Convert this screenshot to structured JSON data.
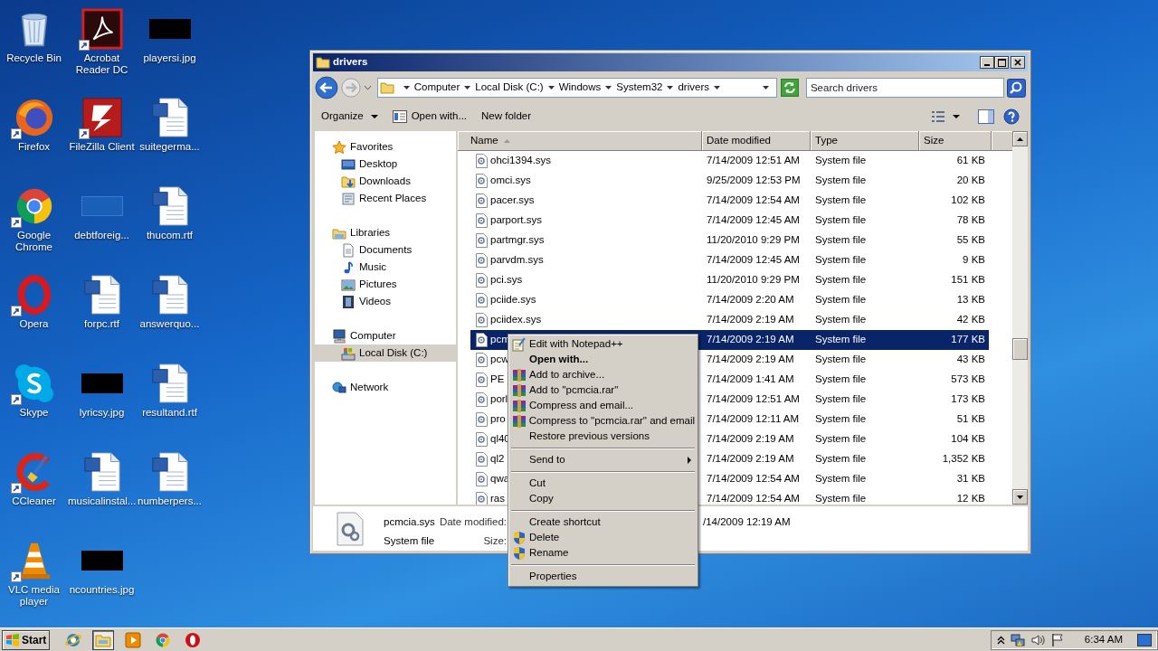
{
  "desktop": {
    "icons": [
      {
        "label": "Recycle Bin",
        "kind": "recycle",
        "shortcut": false
      },
      {
        "label": "Acrobat Reader DC",
        "kind": "acrobat",
        "shortcut": true
      },
      {
        "label": "playersi.jpg",
        "kind": "image",
        "shortcut": false
      },
      {
        "label": "Firefox",
        "kind": "firefox",
        "shortcut": true
      },
      {
        "label": "FileZilla Client",
        "kind": "filezilla",
        "shortcut": true
      },
      {
        "label": "suitegerma...",
        "kind": "word",
        "shortcut": false
      },
      {
        "label": "Google Chrome",
        "kind": "chrome",
        "shortcut": true
      },
      {
        "label": "debtforeig...",
        "kind": "blank",
        "shortcut": false
      },
      {
        "label": "thucom.rtf",
        "kind": "word",
        "shortcut": false
      },
      {
        "label": "Opera",
        "kind": "opera",
        "shortcut": true
      },
      {
        "label": "forpc.rtf",
        "kind": "word",
        "shortcut": false
      },
      {
        "label": "answerquo...",
        "kind": "word",
        "shortcut": false
      },
      {
        "label": "Skype",
        "kind": "skype",
        "shortcut": true
      },
      {
        "label": "lyricsy.jpg",
        "kind": "image",
        "shortcut": false
      },
      {
        "label": "resultand.rtf",
        "kind": "word",
        "shortcut": false
      },
      {
        "label": "CCleaner",
        "kind": "ccleaner",
        "shortcut": true
      },
      {
        "label": "musicalinstal...",
        "kind": "word",
        "shortcut": false
      },
      {
        "label": "numberpers...",
        "kind": "word",
        "shortcut": false
      },
      {
        "label": "VLC media player",
        "kind": "vlc",
        "shortcut": true
      },
      {
        "label": "ncountries.jpg",
        "kind": "image",
        "shortcut": false
      }
    ]
  },
  "explorer": {
    "title": "drivers",
    "breadcrumbs": [
      "Computer",
      "Local Disk (C:)",
      "Windows",
      "System32",
      "drivers"
    ],
    "search": {
      "placeholder": "Search drivers"
    },
    "toolbar": [
      {
        "label": "Organize",
        "kind": "menu"
      },
      {
        "label": "Open with...",
        "kind": "open"
      },
      {
        "label": "New folder",
        "kind": "plain"
      }
    ],
    "nav": [
      {
        "label": "Favorites",
        "kind": "star",
        "selected": false,
        "children": [
          {
            "label": "Desktop",
            "kind": "desktop",
            "selected": false
          },
          {
            "label": "Downloads",
            "kind": "downloads",
            "selected": false
          },
          {
            "label": "Recent Places",
            "kind": "recent",
            "selected": false
          }
        ]
      },
      {
        "label": "Libraries",
        "kind": "libraries",
        "selected": false,
        "children": [
          {
            "label": "Documents",
            "kind": "documents",
            "selected": false
          },
          {
            "label": "Music",
            "kind": "music",
            "selected": false
          },
          {
            "label": "Pictures",
            "kind": "pictures",
            "selected": false
          },
          {
            "label": "Videos",
            "kind": "videos",
            "selected": false
          }
        ]
      },
      {
        "label": "Computer",
        "kind": "computer",
        "selected": false,
        "children": [
          {
            "label": "Local Disk (C:)",
            "kind": "drive",
            "selected": true
          }
        ]
      },
      {
        "label": "Network",
        "kind": "network",
        "selected": false
      }
    ],
    "columns": [
      {
        "label": "Name",
        "sorted": true
      },
      {
        "label": "Date modified",
        "sorted": false
      },
      {
        "label": "Type",
        "sorted": false
      },
      {
        "label": "Size",
        "sorted": false
      }
    ],
    "rows": [
      {
        "name": "ohci1394.sys",
        "date": "7/14/2009 12:51 AM",
        "type": "System file",
        "size": "61 KB",
        "selected": false
      },
      {
        "name": "omci.sys",
        "date": "9/25/2009 12:53 PM",
        "type": "System file",
        "size": "20 KB",
        "selected": false
      },
      {
        "name": "pacer.sys",
        "date": "7/14/2009 12:54 AM",
        "type": "System file",
        "size": "102 KB",
        "selected": false
      },
      {
        "name": "parport.sys",
        "date": "7/14/2009 12:45 AM",
        "type": "System file",
        "size": "78 KB",
        "selected": false
      },
      {
        "name": "partmgr.sys",
        "date": "11/20/2010 9:29 PM",
        "type": "System file",
        "size": "55 KB",
        "selected": false
      },
      {
        "name": "parvdm.sys",
        "date": "7/14/2009 12:45 AM",
        "type": "System file",
        "size": "9 KB",
        "selected": false
      },
      {
        "name": "pci.sys",
        "date": "11/20/2010 9:29 PM",
        "type": "System file",
        "size": "151 KB",
        "selected": false
      },
      {
        "name": "pciide.sys",
        "date": "7/14/2009 2:20 AM",
        "type": "System file",
        "size": "13 KB",
        "selected": false
      },
      {
        "name": "pciidex.sys",
        "date": "7/14/2009 2:19 AM",
        "type": "System file",
        "size": "42 KB",
        "selected": false
      },
      {
        "name": "pcm",
        "date": "7/14/2009 2:19 AM",
        "type": "System file",
        "size": "177 KB",
        "selected": true
      },
      {
        "name": "pcw",
        "date": "7/14/2009 2:19 AM",
        "type": "System file",
        "size": "43 KB",
        "selected": false
      },
      {
        "name": "PE",
        "date": "7/14/2009 1:41 AM",
        "type": "System file",
        "size": "573 KB",
        "selected": false
      },
      {
        "name": "porl",
        "date": "7/14/2009 12:51 AM",
        "type": "System file",
        "size": "173 KB",
        "selected": false
      },
      {
        "name": "pro",
        "date": "7/14/2009 12:11 AM",
        "type": "System file",
        "size": "51 KB",
        "selected": false
      },
      {
        "name": "ql40",
        "date": "7/14/2009 2:19 AM",
        "type": "System file",
        "size": "104 KB",
        "selected": false
      },
      {
        "name": "ql2",
        "date": "7/14/2009 2:19 AM",
        "type": "System file",
        "size": "1,352 KB",
        "selected": false
      },
      {
        "name": "qwa",
        "date": "7/14/2009 12:54 AM",
        "type": "System file",
        "size": "31 KB",
        "selected": false
      },
      {
        "name": "ras",
        "date": "7/14/2009 12:54 AM",
        "type": "System file",
        "size": "12 KB",
        "selected": false
      }
    ],
    "details": {
      "name": "pcmcia.sys",
      "type": "System file",
      "date_label": "Date modified:",
      "date_value": "/14/2009 12:19 AM",
      "size_label": "Size:"
    }
  },
  "context_menu": {
    "items": [
      {
        "kind": "notepad",
        "label": "Edit with Notepad++",
        "bold": false,
        "submenu": false
      },
      {
        "kind": "item",
        "label": "Open with...",
        "bold": true,
        "submenu": false
      },
      {
        "kind": "archive",
        "label": "Add to archive...",
        "bold": false,
        "submenu": false
      },
      {
        "kind": "archive",
        "label": "Add to \"pcmcia.rar\"",
        "bold": false,
        "submenu": false
      },
      {
        "kind": "archive",
        "label": "Compress and email...",
        "bold": false,
        "submenu": false
      },
      {
        "kind": "archive",
        "label": "Compress to \"pcmcia.rar\" and email",
        "bold": false,
        "submenu": false
      },
      {
        "kind": "item",
        "label": "Restore previous versions",
        "bold": false,
        "submenu": false
      },
      {
        "kind": "separator"
      },
      {
        "kind": "item",
        "label": "Send to",
        "bold": false,
        "submenu": true
      },
      {
        "kind": "separator"
      },
      {
        "kind": "item",
        "label": "Cut",
        "bold": false,
        "submenu": false
      },
      {
        "kind": "item",
        "label": "Copy",
        "bold": false,
        "submenu": false
      },
      {
        "kind": "separator"
      },
      {
        "kind": "item",
        "label": "Create shortcut",
        "bold": false,
        "submenu": false
      },
      {
        "kind": "shield",
        "label": "Delete",
        "bold": false,
        "submenu": false
      },
      {
        "kind": "shield",
        "label": "Rename",
        "bold": false,
        "submenu": false
      },
      {
        "kind": "separator"
      },
      {
        "kind": "item",
        "label": "Properties",
        "bold": false,
        "submenu": false
      }
    ]
  },
  "taskbar": {
    "start": "Start",
    "apps": [
      {
        "kind": "ie",
        "active": false
      },
      {
        "kind": "explorer",
        "active": true
      },
      {
        "kind": "media",
        "active": false
      },
      {
        "kind": "chrome",
        "active": false
      },
      {
        "kind": "opera",
        "active": false
      }
    ],
    "time": "6:34 AM"
  }
}
